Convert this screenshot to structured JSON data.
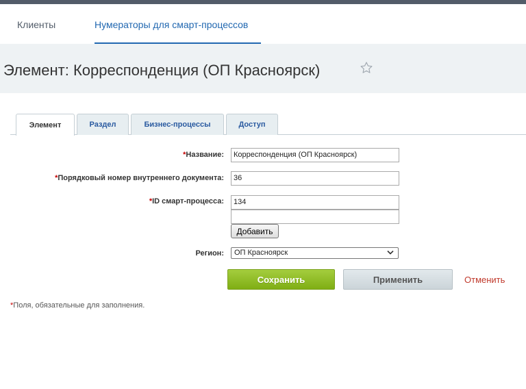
{
  "nav": {
    "items": [
      {
        "label": "Клиенты"
      },
      {
        "label": "Нумераторы для смарт-процессов"
      }
    ]
  },
  "page": {
    "title": "Элемент: Корреспонденция (ОП Красноярск)"
  },
  "tabs": [
    {
      "label": "Элемент"
    },
    {
      "label": "Раздел"
    },
    {
      "label": "Бизнес-процессы"
    },
    {
      "label": "Доступ"
    }
  ],
  "form": {
    "required_mark": "*",
    "name": {
      "label": "Название:",
      "value": "Корреспонденция (ОП Красноярск)"
    },
    "doc_number": {
      "label": "Порядковый номер внутреннего документа:",
      "value": "36"
    },
    "smart_id": {
      "label": "ID смарт-процесса:",
      "values": [
        "134",
        ""
      ]
    },
    "add_label": "Добавить",
    "region": {
      "label": "Регион:",
      "value": "ОП Красноярск"
    }
  },
  "actions": {
    "save": "Сохранить",
    "apply": "Применить",
    "cancel": "Отменить"
  },
  "footnote": {
    "mark": "*",
    "text": "Поля, обязательные для заполнения."
  },
  "colors": {
    "accent": "#2067b0",
    "save": "#8cbd1f",
    "required": "#c40000",
    "cancel": "#c0392b"
  }
}
